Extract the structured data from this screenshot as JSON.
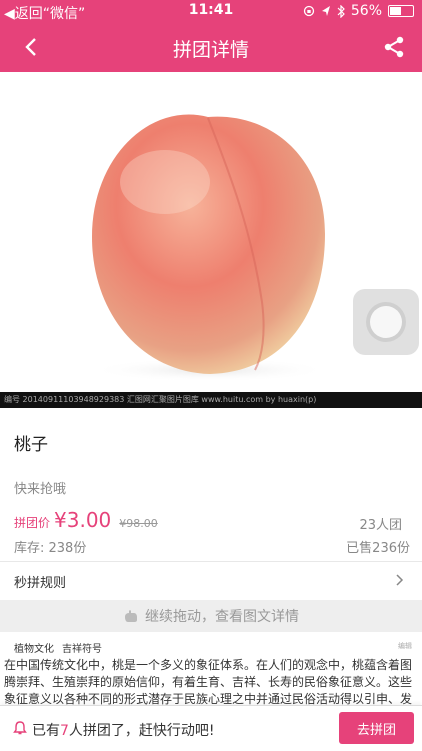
{
  "status_bar": {
    "back_app": "◀返回“微信”",
    "time": "11:41",
    "battery": "56%",
    "battery_level": 0.56
  },
  "header": {
    "title": "拼团详情"
  },
  "image_caption": "编号 20140911103948929383    汇图网汇聚图片图库 www.huitu.com by huaxin(p)",
  "product": {
    "name": "桃子",
    "slogan": "快来抢哦",
    "price_label": "拼团价",
    "price": "¥3.00",
    "original_price": "¥98.00",
    "group_size": "23人团",
    "stock": "库存: 238份",
    "sold": "已售236份"
  },
  "rules_label": "秒拼规则",
  "drag_hint": "继续拖动，查看图文详情",
  "detail": {
    "tag1": "植物文化",
    "tag2": "吉祥符号",
    "edit": "编辑",
    "text": "在中国传统文化中，桃是一个多义的象征体系。在人们的观念中，桃蕴含着图腾崇拜、生殖崇拜的原始信仰，有着生育、吉祥、长寿的民俗象征意义。这些象征意义以各种不同的形式潜存于民族心理之中并通过民俗活动得以引申、发展、整合、变"
  },
  "bottom_bar": {
    "msg_prefix": "已有",
    "count": "7",
    "msg_suffix": "人拼团了，赶快行动吧!",
    "join_button": "去拼团"
  },
  "colors": {
    "accent": "#e6427a"
  }
}
